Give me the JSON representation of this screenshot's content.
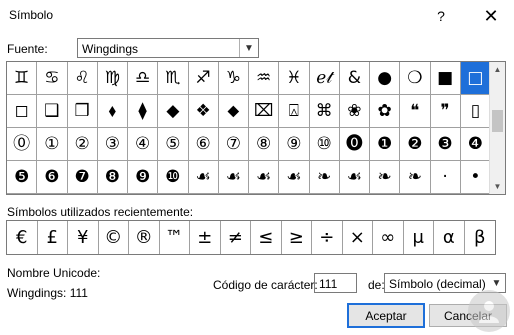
{
  "window": {
    "title": "Símbolo",
    "help": "?",
    "close": "✕"
  },
  "font": {
    "label": "Fuente:",
    "value": "Wingdings"
  },
  "grid": {
    "selected_index": 15,
    "cells": [
      "♊",
      "♋",
      "♌",
      "♍",
      "♎",
      "♏",
      "♐",
      "♑",
      "♒",
      "♓",
      "ℯ𝓉",
      "&",
      "●",
      "❍",
      "■",
      "□",
      "◻",
      "❑",
      "❒",
      "⬧",
      "⧫",
      "◆",
      "❖",
      "⬥",
      "⌧",
      "⍓",
      "⌘",
      "❀",
      "✿",
      "❝",
      "❞",
      "▯",
      "⓪",
      "①",
      "②",
      "③",
      "④",
      "⑤",
      "⑥",
      "⑦",
      "⑧",
      "⑨",
      "⑩",
      "⓿",
      "❶",
      "❷",
      "❸",
      "❹",
      "❺",
      "❻",
      "❼",
      "❽",
      "❾",
      "❿",
      "☙",
      "☙",
      "☙",
      "☙",
      "❧",
      "☙",
      "❧",
      "❧",
      "·",
      "•"
    ]
  },
  "recent": {
    "label": "Símbolos utilizados recientemente:",
    "symbols": [
      "€",
      "£",
      "¥",
      "©",
      "®",
      "™",
      "±",
      "≠",
      "≤",
      "≥",
      "÷",
      "×",
      "∞",
      "μ",
      "α",
      "β"
    ]
  },
  "unicode": {
    "label": "Nombre Unicode:",
    "value": "Wingdings: 111"
  },
  "charcode": {
    "label": "Código de carácter:",
    "value": "111"
  },
  "from": {
    "label": "de:",
    "value": "Símbolo (decimal)"
  },
  "buttons": {
    "ok": "Aceptar",
    "cancel": "Cancelar"
  },
  "colors": {
    "accent": "#1e6fd9",
    "arrow": "#e8615a"
  }
}
